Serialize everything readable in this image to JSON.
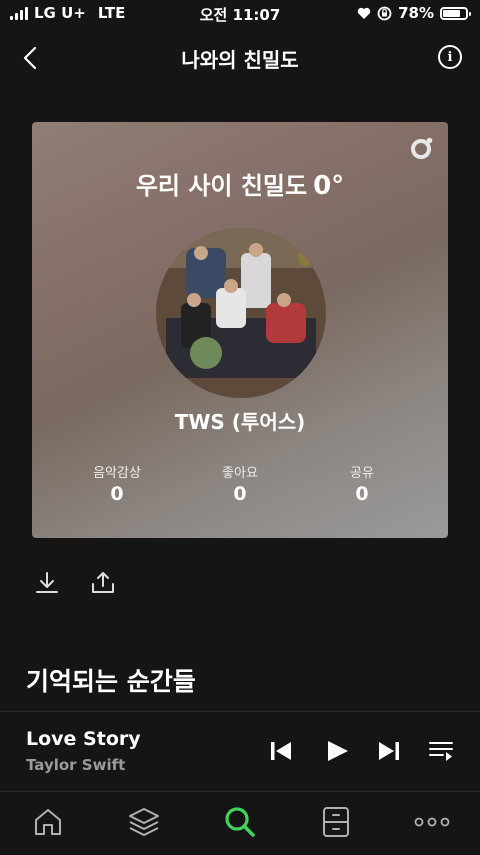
{
  "status_bar": {
    "carrier": "LG U+",
    "network": "LTE",
    "time": "오전 11:07",
    "battery": "78%",
    "battery_level": 0.78
  },
  "header": {
    "title": "나와의 친밀도",
    "back_icon": "chevron-left-icon",
    "info_icon": "info-icon"
  },
  "card": {
    "intimacy_label": "우리 사이 친밀도",
    "intimacy_value": "0°",
    "artist_name": "TWS (투어스)",
    "stats": [
      {
        "label": "음악감상",
        "value": "0"
      },
      {
        "label": "좋아요",
        "value": "0"
      },
      {
        "label": "공유",
        "value": "0"
      }
    ]
  },
  "actions": {
    "download_icon": "download-icon",
    "share_icon": "share-icon"
  },
  "section_title": "기억되는 순간들",
  "player": {
    "song": "Love Story",
    "artist": "Taylor Swift"
  },
  "tabs": [
    "home-icon",
    "library-icon",
    "search-icon",
    "storage-icon",
    "more-icon"
  ],
  "colors": {
    "accent": "#3fd45c",
    "background": "#151515",
    "secondary_text": "#9a9a9a"
  }
}
